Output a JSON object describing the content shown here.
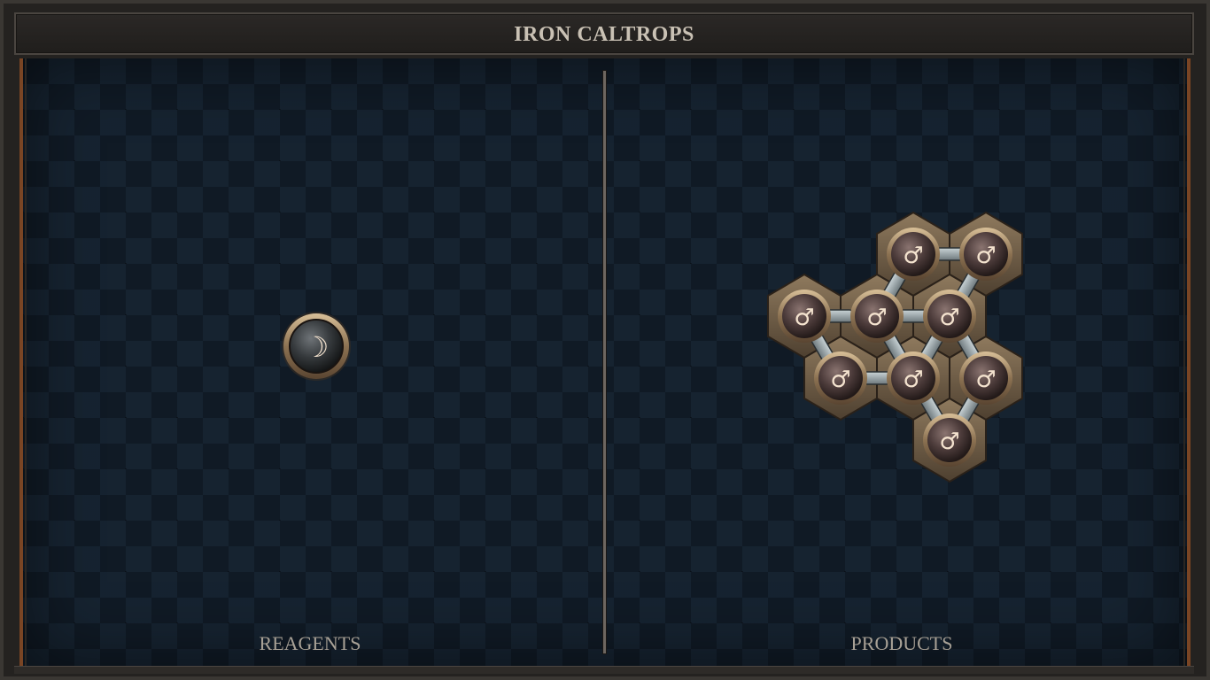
{
  "header": {
    "title": "IRON CALTROPS"
  },
  "sections": {
    "reagents_label": "REAGENTS",
    "products_label": "PRODUCTS"
  },
  "reagents": [
    {
      "element": "silver",
      "glyph": "☽"
    }
  ],
  "products": {
    "atoms": [
      {
        "element": "iron",
        "glyph": "♂"
      },
      {
        "element": "iron",
        "glyph": "♂"
      },
      {
        "element": "iron",
        "glyph": "♂"
      },
      {
        "element": "iron",
        "glyph": "♂"
      },
      {
        "element": "iron",
        "glyph": "♂"
      },
      {
        "element": "iron",
        "glyph": "♂"
      },
      {
        "element": "iron",
        "glyph": "♂"
      },
      {
        "element": "iron",
        "glyph": "♂"
      },
      {
        "element": "iron",
        "glyph": "♂"
      }
    ]
  },
  "colors": {
    "board": "#101a25",
    "frame": "#242220",
    "accent_copper": "#7a4524",
    "atom_glyph": "#f4e3cf",
    "atom_rim": "#b89a72"
  }
}
